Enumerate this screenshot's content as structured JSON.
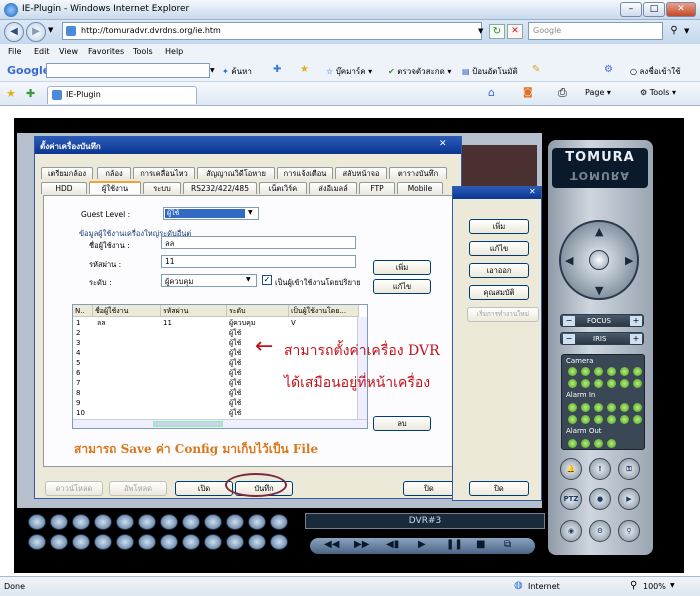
{
  "window": {
    "title": "IE-Plugin - Windows Internet Explorer"
  },
  "address": {
    "url": "http://tomuradvr.dvrdns.org/ie.htm",
    "search_placeholder": "Google"
  },
  "menu": [
    "File",
    "Edit",
    "View",
    "Favorites",
    "Tools",
    "Help"
  ],
  "google_bar": {
    "logo": "Google",
    "items": [
      "ค้นหา",
      "บุ๊คมาร์ค",
      "ตรวจตัวสะกด",
      "ป้อนอัตโนมัติ",
      "ลงชื่อเข้าใช้"
    ]
  },
  "favbar": {
    "tab": "IE-Plugin",
    "page": "Page",
    "tools": "Tools"
  },
  "dialog": {
    "title": "ตั้งค่าเครื่องบันทึก",
    "tabs_row1": [
      "เตรียมกล้อง",
      "กล้อง",
      "การเคลื่อนไหว",
      "สัญญาณวิดีโอหาย",
      "การแจ้งเตือน",
      "สลับหน้าจอ",
      "ตารางบันทึก"
    ],
    "tabs_row2": [
      "HDD",
      "ผู้ใช้งาน",
      "ระบบ",
      "RS232/422/485",
      "เน็ตเวิร์ค",
      "ส่งอีเมลล์",
      "FTP",
      "Mobile"
    ],
    "guest_level_label": "Guest Level :",
    "guest_level_value": "ผู้ใช้",
    "section_label": "ข้อมูลผู้ใช้งานเครื่องใหญ่ระดับอื่นต่",
    "username_label": "ชื่อผู้ใช้งาน :",
    "username_value": "ลล",
    "password_label": "รหัสผ่าน :",
    "password_value": "11",
    "level_label": "ระดับ :",
    "level_value": "ผู้ควบคุม",
    "default_user_checkbox": "เป็นผู้เข้าใช้งานโดยปริยาย",
    "add_button": "เพิ่ม",
    "edit_button": "แก้ไข",
    "delete_button": "ลบ",
    "table": {
      "headers": [
        "N..",
        "ชื่อผู้ใช้งาน",
        "รหัสผ่าน",
        "ระดับ",
        "เป็นผู้ใช้งานโดย..."
      ],
      "rows": [
        [
          "1",
          "ลล",
          "11",
          "ผู้ควบคุม",
          "V"
        ],
        [
          "2",
          "",
          "",
          "ผู้ใช้",
          ""
        ],
        [
          "3",
          "",
          "",
          "ผู้ใช้",
          ""
        ],
        [
          "4",
          "",
          "",
          "ผู้ใช้",
          ""
        ],
        [
          "5",
          "",
          "",
          "ผู้ใช้",
          ""
        ],
        [
          "6",
          "",
          "",
          "ผู้ใช้",
          ""
        ],
        [
          "7",
          "",
          "",
          "ผู้ใช้",
          ""
        ],
        [
          "8",
          "",
          "",
          "ผู้ใช้",
          ""
        ],
        [
          "9",
          "",
          "",
          "ผู้ใช้",
          ""
        ],
        [
          "10",
          "",
          "",
          "ผู้ใช้",
          ""
        ]
      ]
    },
    "footer": {
      "download": "ดาวน์โหลด",
      "upload": "อัพโหลด",
      "open": "เปิด",
      "save": "บันทึก",
      "close": "ปิด"
    }
  },
  "dialog2": {
    "buttons": [
      "เพิ่ม",
      "แก้ไข",
      "เอาออก",
      "คุณสมบัติ",
      "เริ่มการทำงานใหม่"
    ],
    "close": "ปิด"
  },
  "annotations": {
    "line1": "สามารถตั้งค่าเครื่อง DVR",
    "line2": "ได้เสมือนอยู่ที่หน้าเครื่อง",
    "line3": "สามารถ Save ค่า Config มาเก็บไว้เป็น File"
  },
  "dvr": {
    "brand": "TOMURA",
    "focus": "FOCUS",
    "iris": "IRIS",
    "camera": "Camera",
    "alarm_in": "Alarm In",
    "alarm_out": "Alarm Out",
    "display": "DVR#3"
  },
  "statusbar": {
    "left": "Done",
    "zone": "Internet",
    "zoom": "100%"
  }
}
